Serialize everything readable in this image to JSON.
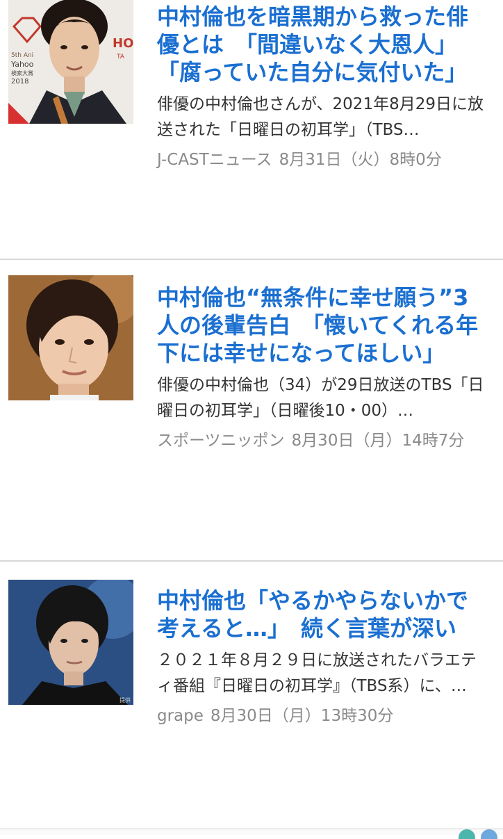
{
  "articles": [
    {
      "title": "中村倫也を暗黒期から救った俳優とは　「間違いなく大恩人」「腐っていた自分に気付いた」",
      "snippet": "俳優の中村倫也さんが、2021年8月29日に放送された「日曜日の初耳学」（TBS…",
      "source": "J-CASTニュース",
      "date": "8月31日（火）8時0分",
      "thumb_text": [
        "5th Ani",
        "Yahoo",
        "検索大賞",
        "2018",
        "HO",
        "TA"
      ]
    },
    {
      "title": "中村倫也“無条件に幸せ願う”3人の後輩告白　「懐いてくれる年下には幸せになってほしい」",
      "snippet": "俳優の中村倫也（34）が29日放送のTBS「日曜日の初耳学」（日曜後10・00）…",
      "source": "スポーツニッポン",
      "date": "8月30日（月）14時7分"
    },
    {
      "title": "中村倫也「やるかやらないかで考えると…」　続く言葉が深い",
      "snippet": "２０２１年８月２９日に放送されたバラエティ番組『日曜日の初耳学』（TBS系）に、…",
      "source": "grape",
      "date": "8月30日（月）13時30分",
      "thumb_text": [
        "提供"
      ]
    }
  ],
  "colors": {
    "title": "#1a6fd1",
    "snippet": "#333333",
    "meta": "#8a8a8a",
    "divider": "#d8d8d8"
  }
}
